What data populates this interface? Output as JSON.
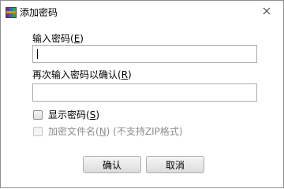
{
  "window": {
    "title": "添加密码",
    "close_glyph": "✕",
    "app_icon": "winrar-icon"
  },
  "password": {
    "label_prefix": "输入密码(",
    "label_key": "E",
    "label_suffix": ")",
    "value": ""
  },
  "confirm_password": {
    "label_prefix": "再次输入密码以确认(",
    "label_key": "R",
    "label_suffix": ")",
    "value": ""
  },
  "options": {
    "show_password": {
      "label_prefix": "显示密码(",
      "label_key": "S",
      "label_suffix": ")",
      "checked": false,
      "enabled": true
    },
    "encrypt_filenames": {
      "label_prefix": "加密文件名(",
      "label_key": "N",
      "label_suffix": ")",
      "note": " (不支持ZIP格式)",
      "checked": false,
      "enabled": false
    }
  },
  "buttons": {
    "ok_label": "确认",
    "cancel_label": "取消"
  },
  "colors": {
    "window_bg": "#ffffff",
    "disabled_text": "#8d8d8d",
    "border": "#abadb3"
  }
}
